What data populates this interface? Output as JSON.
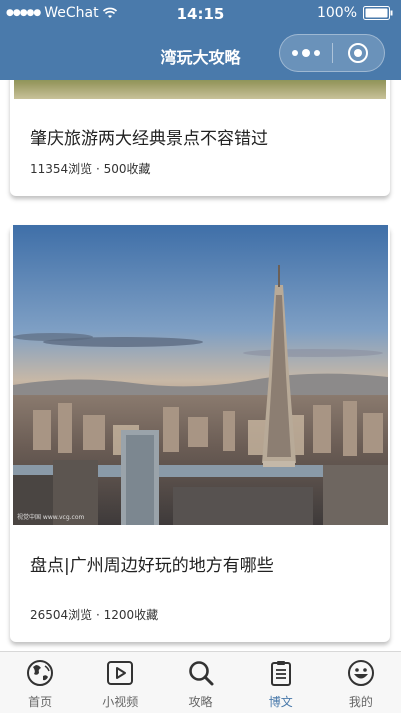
{
  "status_bar": {
    "signal_dots": "●●●●●",
    "carrier": "WeChat",
    "time": "14:15",
    "battery": "100%"
  },
  "nav": {
    "title": "湾玩大攻略"
  },
  "articles": [
    {
      "title": "肇庆旅游两大经典景点不容错过",
      "stats": "11354浏览 · 500收藏"
    },
    {
      "title": "盘点|广州周边好玩的地方有哪些",
      "stats": "26504浏览 · 1200收藏",
      "watermark": "视觉中国 www.vcg.com"
    }
  ],
  "tabs": [
    {
      "label": "首页",
      "icon": "globe-icon",
      "active": false
    },
    {
      "label": "小视频",
      "icon": "play-icon",
      "active": false
    },
    {
      "label": "攻略",
      "icon": "search-icon",
      "active": false
    },
    {
      "label": "博文",
      "icon": "clipboard-icon",
      "active": true
    },
    {
      "label": "我的",
      "icon": "smiley-icon",
      "active": false
    }
  ],
  "colors": {
    "nav_bg": "#4a7aab",
    "active_tab": "#4a7aab",
    "inactive_tab": "#666666"
  }
}
